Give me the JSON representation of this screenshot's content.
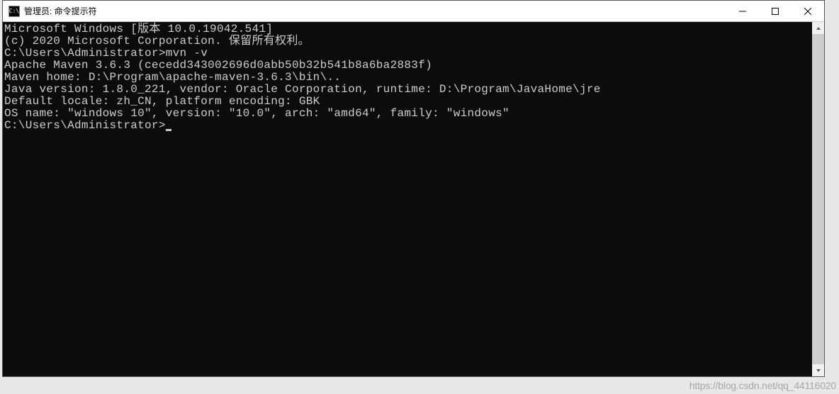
{
  "window": {
    "icon_text": "C:\\",
    "title": "管理员: 命令提示符"
  },
  "terminal": {
    "line1": "Microsoft Windows [版本 10.0.19042.541]",
    "line2": "(c) 2020 Microsoft Corporation. 保留所有权利。",
    "blank1": "",
    "prompt1": "C:\\Users\\Administrator>mvn -v",
    "out1": "Apache Maven 3.6.3 (cecedd343002696d0abb50b32b541b8a6ba2883f)",
    "out2": "Maven home: D:\\Program\\apache-maven-3.6.3\\bin\\..",
    "out3": "Java version: 1.8.0_221, vendor: Oracle Corporation, runtime: D:\\Program\\JavaHome\\jre",
    "out4": "Default locale: zh_CN, platform encoding: GBK",
    "out5": "OS name: \"windows 10\", version: \"10.0\", arch: \"amd64\", family: \"windows\"",
    "blank2": "",
    "prompt2": "C:\\Users\\Administrator>"
  },
  "watermark": "https://blog.csdn.net/qq_44116020"
}
